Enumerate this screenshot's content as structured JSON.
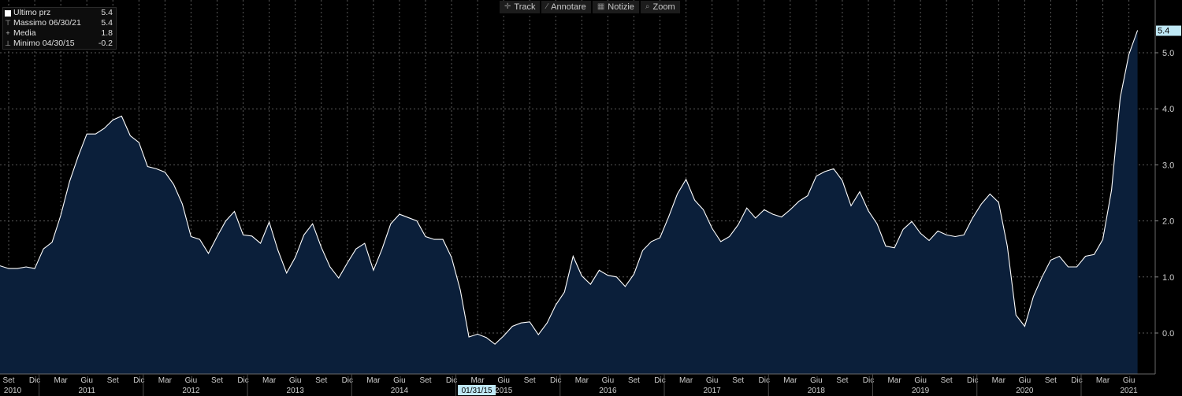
{
  "toolbar": {
    "items": [
      {
        "label": "Track",
        "icon": "crosshair-icon"
      },
      {
        "label": "Annotare",
        "icon": "pencil-icon"
      },
      {
        "label": "Notizie",
        "icon": "news-icon"
      },
      {
        "label": "Zoom",
        "icon": "magnifier-icon"
      }
    ]
  },
  "legend": {
    "rows": [
      {
        "label": "Ultimo prz",
        "value": "5.4"
      },
      {
        "label": "Massimo 06/30/21",
        "value": "5.4"
      },
      {
        "label": "Media",
        "value": "1.8"
      },
      {
        "label": "Minimo 04/30/15",
        "value": "-0.2"
      }
    ]
  },
  "colors": {
    "background": "#000000",
    "fill": "#0b1f3a",
    "line": "#ffffff",
    "grid": "#5a5a5a",
    "highlight": "#bfe8f5"
  },
  "chart_data": {
    "type": "area",
    "ylim": [
      -0.5,
      5.6
    ],
    "y_ticks": [
      "0.0",
      "1.0",
      "2.0",
      "3.0",
      "4.0",
      "5.0"
    ],
    "grid": true,
    "last_value_label": "5.4",
    "cursor_label": "01/31/15",
    "x_month_labels": [
      "Set",
      "Dic",
      "Mar",
      "Giu",
      "Set",
      "Dic",
      "Mar",
      "Giu",
      "Set",
      "Dic",
      "Mar",
      "Giu",
      "Set",
      "Dic",
      "Mar",
      "Giu",
      "Set",
      "Dic",
      "Mar",
      "Giu",
      "Set",
      "Dic",
      "Mar",
      "Giu",
      "Set",
      "Dic",
      "Mar",
      "Giu",
      "Set",
      "Dic",
      "Mar",
      "Giu",
      "Set",
      "Dic",
      "Mar",
      "Giu",
      "Set",
      "Dic",
      "Mar",
      "Giu",
      "Set",
      "Dic",
      "Mar",
      "Giu"
    ],
    "x_year_labels": [
      "2010",
      "2011",
      "2012",
      "2013",
      "2014",
      "2015",
      "2016",
      "2017",
      "2018",
      "2019",
      "2020",
      "2021"
    ],
    "series": [
      {
        "values": [
          1.2,
          1.15,
          1.15,
          1.18,
          1.15,
          1.5,
          1.62,
          2.1,
          2.7,
          3.15,
          3.55,
          3.55,
          3.65,
          3.8,
          3.87,
          3.52,
          3.4,
          2.97,
          2.93,
          2.87,
          2.65,
          2.3,
          1.72,
          1.67,
          1.42,
          1.72,
          2.0,
          2.17,
          1.75,
          1.73,
          1.6,
          1.98,
          1.48,
          1.07,
          1.35,
          1.75,
          1.95,
          1.53,
          1.18,
          0.98,
          1.25,
          1.5,
          1.6,
          1.12,
          1.5,
          1.95,
          2.12,
          2.06,
          2.0,
          1.72,
          1.67,
          1.67,
          1.35,
          0.77,
          -0.07,
          -0.02,
          -0.08,
          -0.2,
          -0.05,
          0.12,
          0.18,
          0.2,
          -0.03,
          0.18,
          0.5,
          0.73,
          1.37,
          1.02,
          0.87,
          1.12,
          1.03,
          1.0,
          0.83,
          1.05,
          1.47,
          1.63,
          1.7,
          2.07,
          2.48,
          2.74,
          2.37,
          2.2,
          1.87,
          1.63,
          1.72,
          1.93,
          2.23,
          2.05,
          2.2,
          2.12,
          2.07,
          2.2,
          2.35,
          2.45,
          2.8,
          2.88,
          2.93,
          2.72,
          2.27,
          2.52,
          2.18,
          1.95,
          1.55,
          1.52,
          1.85,
          1.99,
          1.78,
          1.65,
          1.82,
          1.75,
          1.72,
          1.75,
          2.05,
          2.3,
          2.48,
          2.33,
          1.55,
          0.32,
          0.12,
          0.65,
          1.0,
          1.3,
          1.37,
          1.18,
          1.18,
          1.37,
          1.4,
          1.67,
          2.55,
          4.2,
          4.97,
          5.4
        ]
      }
    ]
  }
}
